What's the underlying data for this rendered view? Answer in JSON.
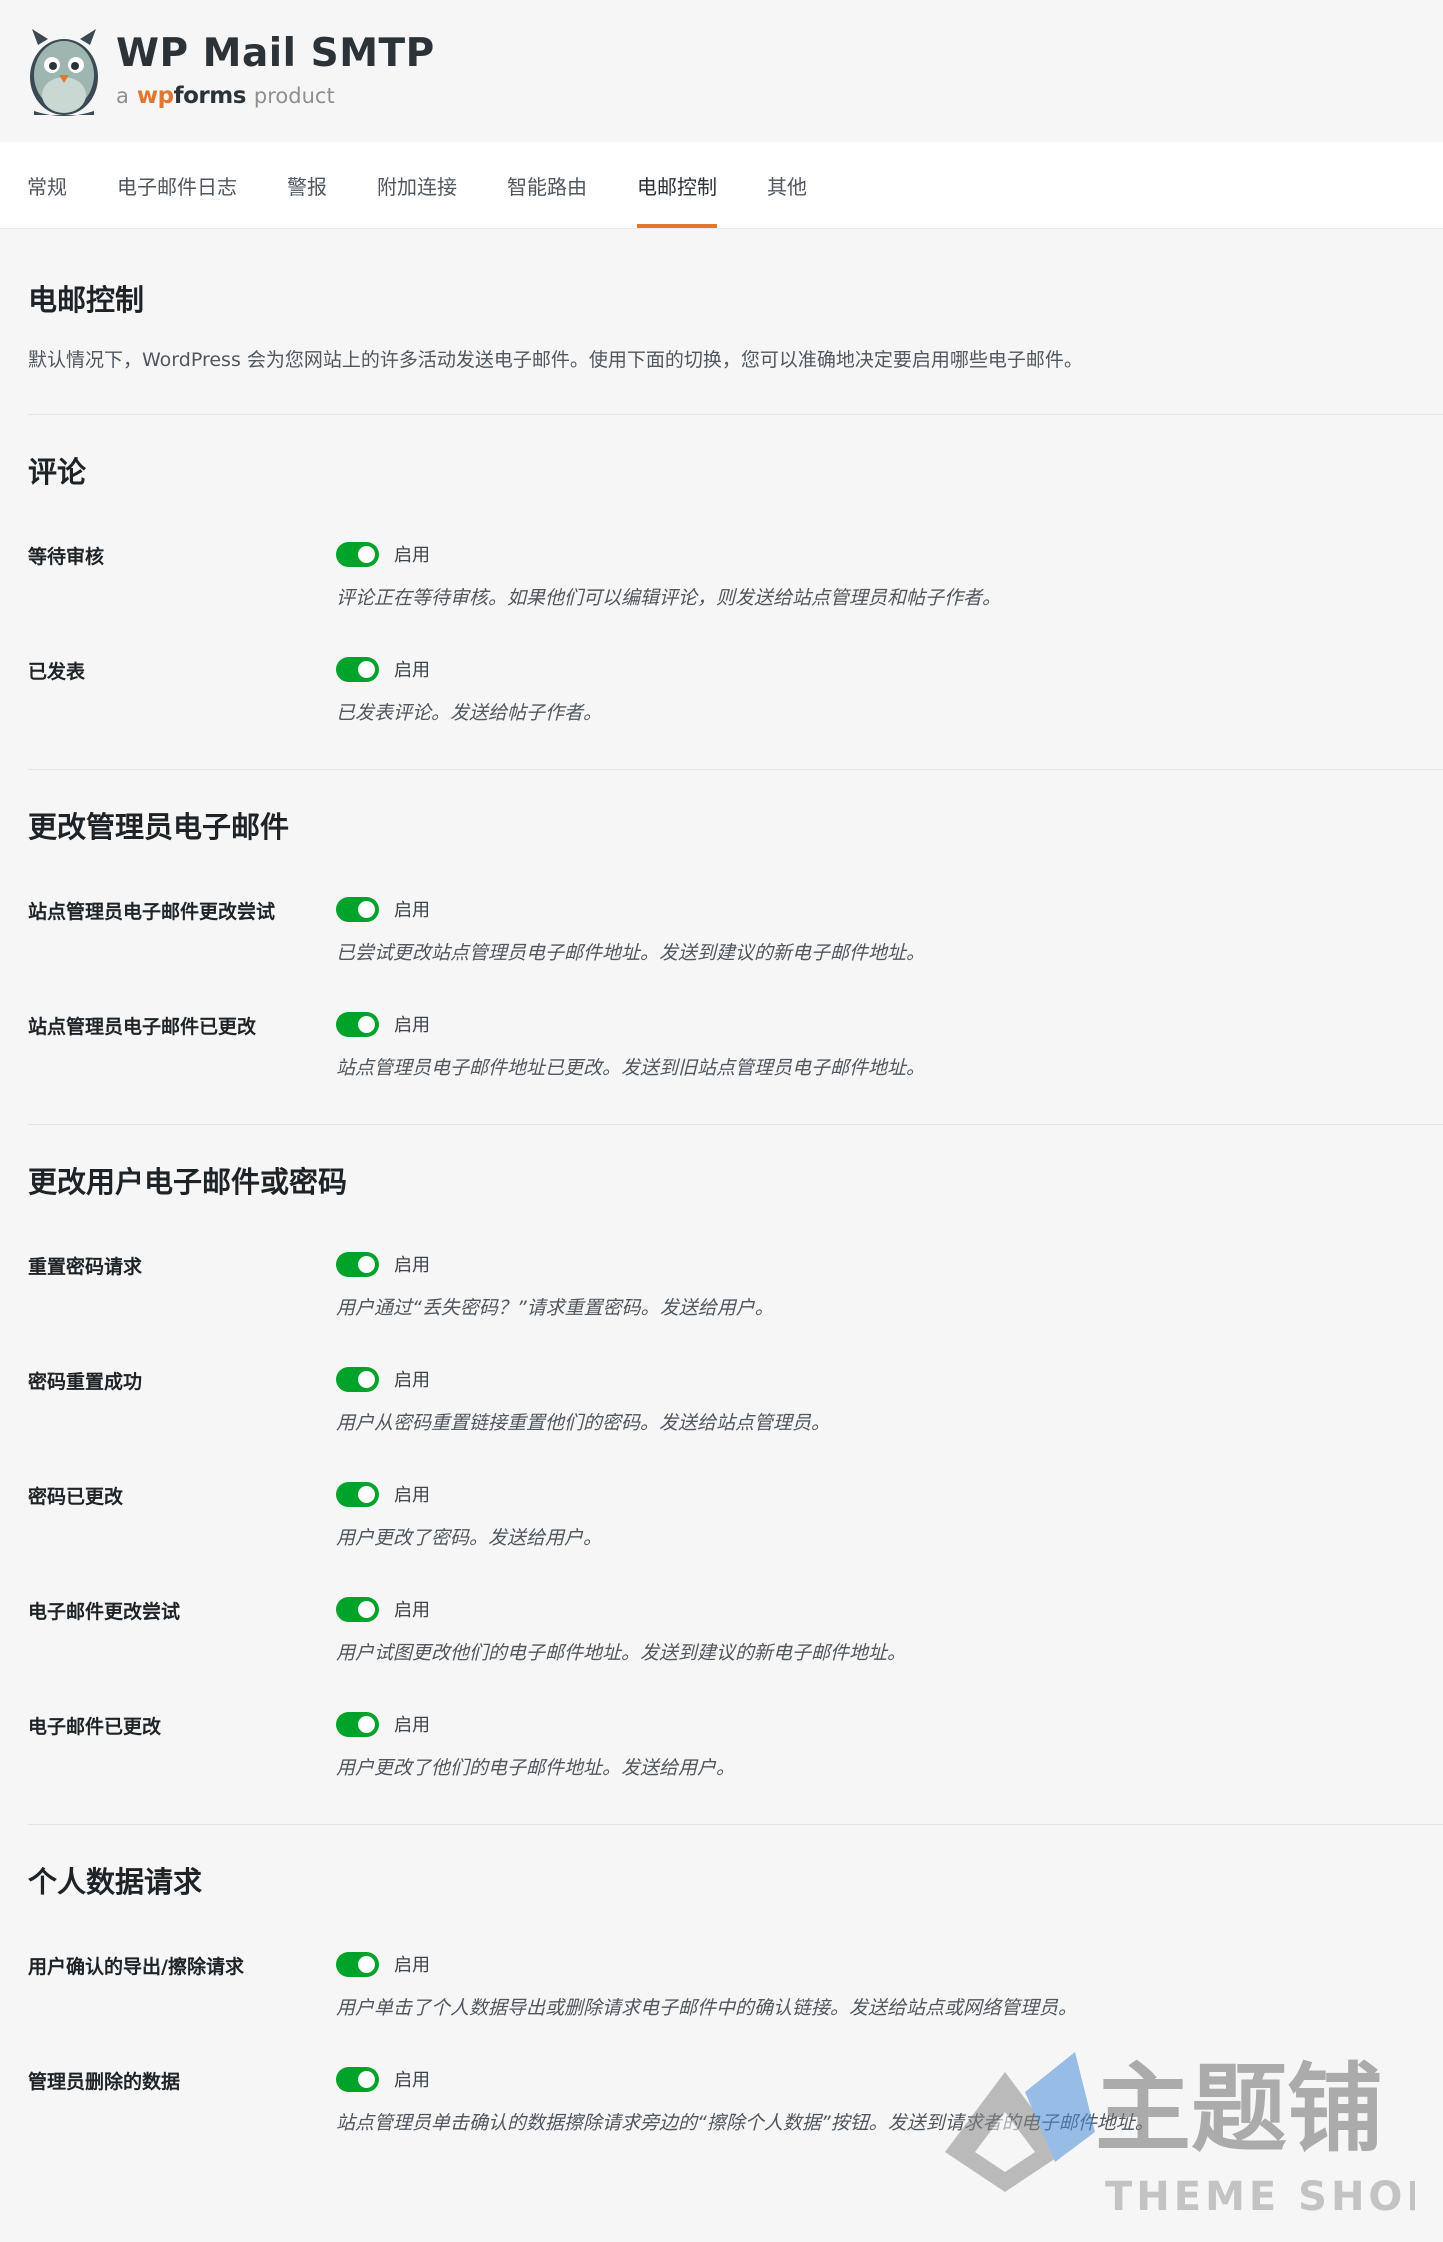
{
  "header": {
    "title": "WP Mail SMTP",
    "sub_a": "a",
    "sub_wp": "wp",
    "sub_forms": "forms",
    "sub_product": "product"
  },
  "tabs": [
    "常规",
    "电子邮件日志",
    "警报",
    "附加连接",
    "智能路由",
    "电邮控制",
    "其他"
  ],
  "page": {
    "title": "电邮控制",
    "description": "默认情况下，WordPress 会为您网站上的许多活动发送电子邮件。使用下面的切换，您可以准确地决定要启用哪些电子邮件。"
  },
  "toggle_label": "启用",
  "sections": [
    {
      "title": "评论",
      "rows": [
        {
          "label": "等待审核",
          "desc": "评论正在等待审核。如果他们可以编辑评论，则发送给站点管理员和帖子作者。",
          "enabled": true
        },
        {
          "label": "已发表",
          "desc": "已发表评论。发送给帖子作者。",
          "enabled": true
        }
      ]
    },
    {
      "title": "更改管理员电子邮件",
      "rows": [
        {
          "label": "站点管理员电子邮件更改尝试",
          "desc": "已尝试更改站点管理员电子邮件地址。发送到建议的新电子邮件地址。",
          "enabled": true
        },
        {
          "label": "站点管理员电子邮件已更改",
          "desc": "站点管理员电子邮件地址已更改。发送到旧站点管理员电子邮件地址。",
          "enabled": true
        }
      ]
    },
    {
      "title": "更改用户电子邮件或密码",
      "rows": [
        {
          "label": "重置密码请求",
          "desc": "用户通过“丢失密码？”请求重置密码。发送给用户。",
          "enabled": true
        },
        {
          "label": "密码重置成功",
          "desc": "用户从密码重置链接重置他们的密码。发送给站点管理员。",
          "enabled": true
        },
        {
          "label": "密码已更改",
          "desc": "用户更改了密码。发送给用户。",
          "enabled": true
        },
        {
          "label": "电子邮件更改尝试",
          "desc": "用户试图更改他们的电子邮件地址。发送到建议的新电子邮件地址。",
          "enabled": true
        },
        {
          "label": "电子邮件已更改",
          "desc": "用户更改了他们的电子邮件地址。发送给用户。",
          "enabled": true
        }
      ]
    },
    {
      "title": "个人数据请求",
      "rows": [
        {
          "label": "用户确认的导出/擦除请求",
          "desc": "用户单击了个人数据导出或删除请求电子邮件中的确认链接。发送给站点或网络管理员。",
          "enabled": true
        },
        {
          "label": "管理员删除的数据",
          "desc": "站点管理员单击确认的数据擦除请求旁边的“擦除个人数据”按钮。发送到请求者的电子邮件地址。",
          "enabled": true
        }
      ]
    }
  ],
  "watermark": {
    "cn": "主题铺",
    "en": "THEME SHOP"
  },
  "colors": {
    "accent": "#e27730",
    "toggle_on": "#00a32a"
  }
}
